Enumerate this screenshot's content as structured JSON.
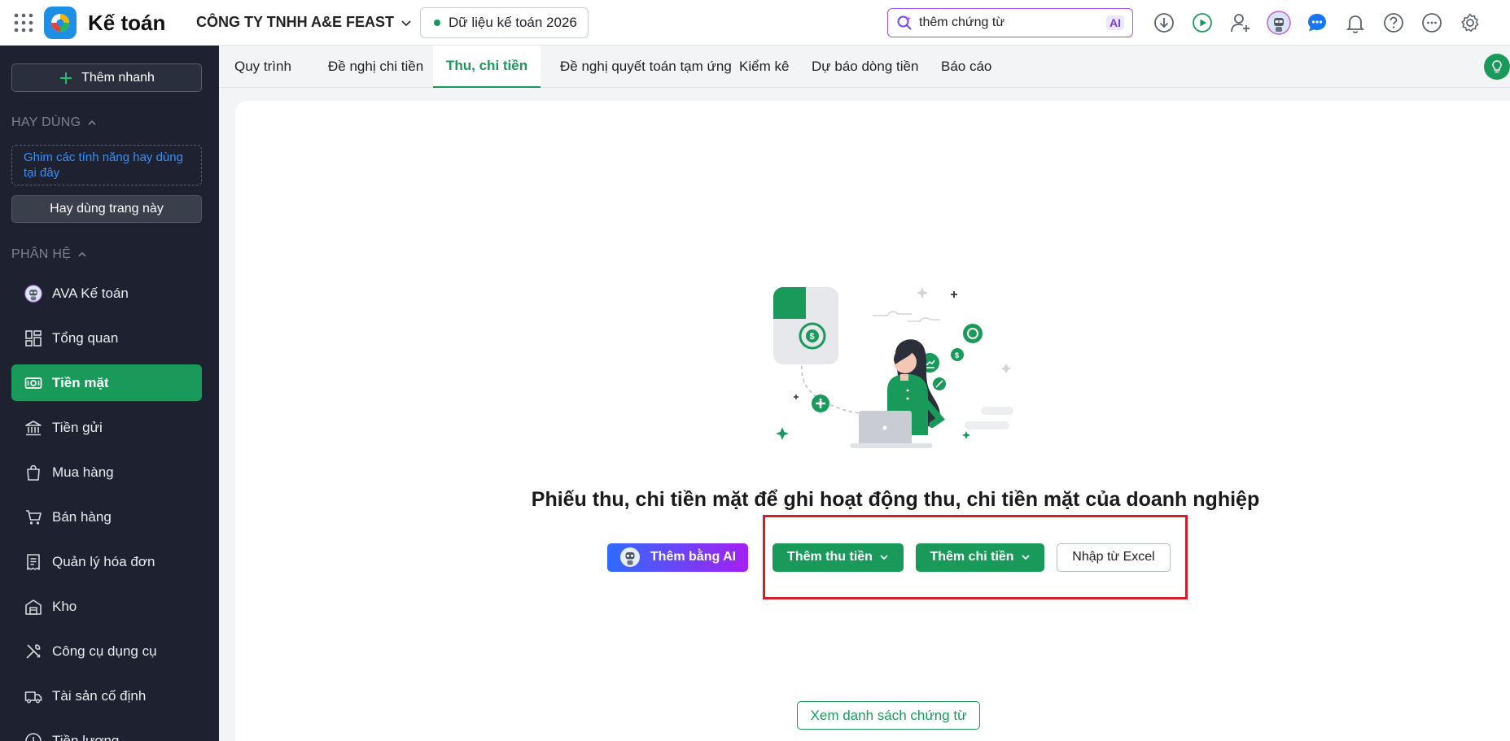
{
  "app": {
    "name": "Kế toán",
    "company": "CÔNG TY TNHH A&E FEAST",
    "data_year": "Dữ liệu kế toán 2026"
  },
  "search": {
    "value": "thêm chứng từ",
    "ai_badge": "AI"
  },
  "sidebar": {
    "quick_add": "Thêm nhanh",
    "favorites_label": "HAY DÙNG",
    "pin_hint": "Ghim các tính năng hay dùng tại đây",
    "favorite_page": "Hay dùng trang này",
    "modules_label": "PHÂN HỆ",
    "items": [
      {
        "label": "AVA Kế toán",
        "icon": "ava-robot-icon"
      },
      {
        "label": "Tổng quan",
        "icon": "dashboard-icon"
      },
      {
        "label": "Tiền mặt",
        "icon": "cash-icon"
      },
      {
        "label": "Tiền gửi",
        "icon": "bank-icon"
      },
      {
        "label": "Mua hàng",
        "icon": "shopping-bag-icon"
      },
      {
        "label": "Bán hàng",
        "icon": "cart-icon"
      },
      {
        "label": "Quản lý hóa đơn",
        "icon": "invoice-icon"
      },
      {
        "label": "Kho",
        "icon": "warehouse-icon"
      },
      {
        "label": "Công cụ dụng cụ",
        "icon": "tools-icon"
      },
      {
        "label": "Tài sản cố định",
        "icon": "truck-icon"
      },
      {
        "label": "Tiền lương",
        "icon": "salary-icon"
      }
    ],
    "active_item": "Tiền mặt"
  },
  "tabs": [
    {
      "label": "Quy trình"
    },
    {
      "label": "Đề nghị chi tiền"
    },
    {
      "label": "Thu, chi tiền"
    },
    {
      "label": "Đề nghị quyết toán tạm ứng"
    },
    {
      "label": "Kiểm kê"
    },
    {
      "label": "Dự báo dòng tiền"
    },
    {
      "label": "Báo cáo"
    }
  ],
  "active_tab": "Thu, chi tiền",
  "main": {
    "headline": "Phiếu thu, chi tiền mặt để ghi hoạt động thu, chi tiền mặt của doanh nghiệp",
    "btn_ai": "Thêm bằng AI",
    "btn_receipt": "Thêm thu tiền",
    "btn_payment": "Thêm chi tiền",
    "btn_excel": "Nhập từ Excel",
    "btn_list": "Xem danh sách chứng từ"
  },
  "colors": {
    "accent": "#1a9a5a",
    "sidebar": "#1e2230",
    "highlight": "#d11f2a",
    "ai_gradient_start": "#2f6bff",
    "ai_gradient_end": "#a51ff5"
  }
}
